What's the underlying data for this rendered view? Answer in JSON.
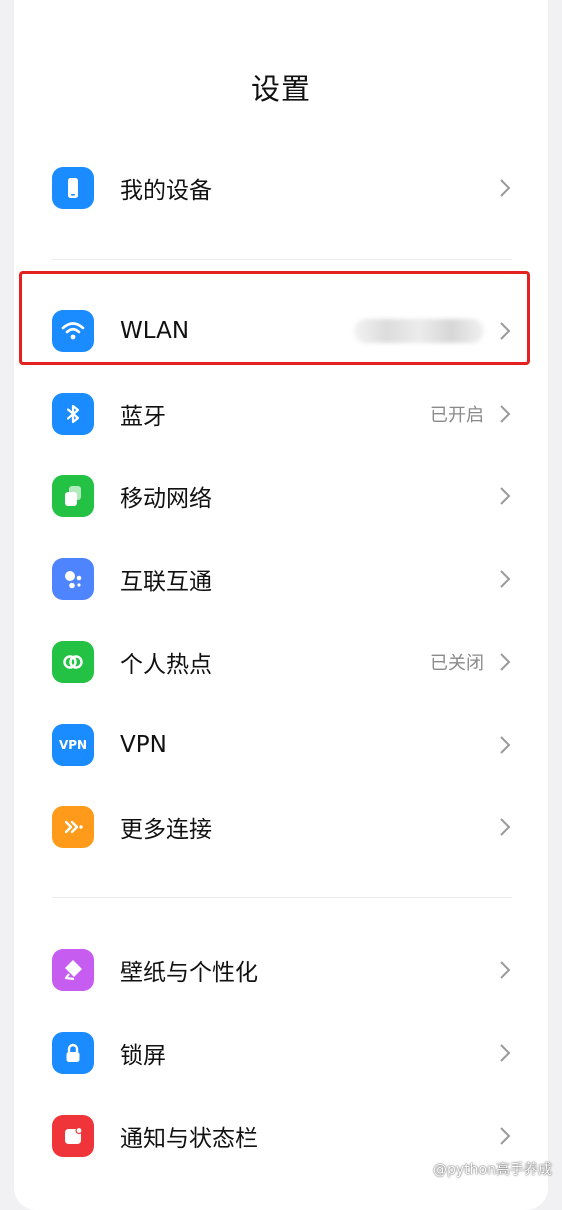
{
  "header": {
    "title": "设置"
  },
  "items": [
    {
      "id": "my-device",
      "label": "我的设备",
      "value": "",
      "icon": "phone-icon",
      "color": "#1a8cff"
    },
    {
      "id": "wlan",
      "label": "WLAN",
      "value": "",
      "icon": "wifi-icon",
      "color": "#1a8cff"
    },
    {
      "id": "bluetooth",
      "label": "蓝牙",
      "value": "已开启",
      "icon": "bluetooth-icon",
      "color": "#1a8cff"
    },
    {
      "id": "mobile-network",
      "label": "移动网络",
      "value": "",
      "icon": "mobile-network-icon",
      "color": "#23c244"
    },
    {
      "id": "interconnect",
      "label": "互联互通",
      "value": "",
      "icon": "interconnect-icon",
      "color": "#4f84ff"
    },
    {
      "id": "hotspot",
      "label": "个人热点",
      "value": "已关闭",
      "icon": "hotspot-icon",
      "color": "#23c244"
    },
    {
      "id": "vpn",
      "label": "VPN",
      "value": "",
      "icon": "vpn-icon",
      "color": "#1a8cff",
      "icon_text": "VPN"
    },
    {
      "id": "more-connections",
      "label": "更多连接",
      "value": "",
      "icon": "more-connections-icon",
      "color": "#ff9a1a"
    },
    {
      "id": "wallpaper",
      "label": "壁纸与个性化",
      "value": "",
      "icon": "wallpaper-icon",
      "color": "#c65cf0"
    },
    {
      "id": "lock-screen",
      "label": "锁屏",
      "value": "",
      "icon": "lock-icon",
      "color": "#1a8cff"
    },
    {
      "id": "notifications",
      "label": "通知与状态栏",
      "value": "",
      "icon": "notification-icon",
      "color": "#f0353a"
    }
  ],
  "highlight": {
    "target": "wlan",
    "color": "#e3211f"
  },
  "watermark": {
    "text": "@python高手养成"
  }
}
